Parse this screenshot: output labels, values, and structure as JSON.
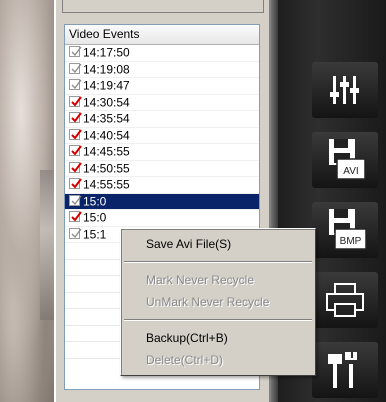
{
  "list": {
    "header": "Video Events",
    "events": [
      {
        "time": "14:17:50",
        "marked": false
      },
      {
        "time": "14:19:08",
        "marked": false
      },
      {
        "time": "14:19:47",
        "marked": false
      },
      {
        "time": "14:30:54",
        "marked": true
      },
      {
        "time": "14:35:54",
        "marked": true
      },
      {
        "time": "14:40:54",
        "marked": true
      },
      {
        "time": "14:45:55",
        "marked": true
      },
      {
        "time": "14:50:55",
        "marked": true
      },
      {
        "time": "14:55:55",
        "marked": true
      },
      {
        "time": "15:0",
        "marked": false,
        "selected": true
      },
      {
        "time": "15:0",
        "marked": true
      },
      {
        "time": "15:1",
        "marked": false
      }
    ]
  },
  "context_menu": {
    "items": [
      {
        "label": "Save Avi File(S)",
        "enabled": true
      },
      {
        "separator": true
      },
      {
        "label": "Mark Never Recycle",
        "enabled": false
      },
      {
        "label": "UnMark Never Recycle",
        "enabled": false
      },
      {
        "separator": true
      },
      {
        "label": "Backup(Ctrl+B)",
        "enabled": true
      },
      {
        "label": "Delete(Ctrl+D)",
        "enabled": false
      }
    ]
  },
  "toolbar": {
    "buttons": [
      {
        "icon": "sliders-icon"
      },
      {
        "icon": "save-avi-icon",
        "badge": "AVI"
      },
      {
        "icon": "save-bmp-icon",
        "badge": "BMP"
      },
      {
        "icon": "printer-icon"
      },
      {
        "icon": "tools-icon"
      }
    ]
  },
  "colors": {
    "selection": "#0a246a",
    "check_red": "#d40000",
    "check_gray": "#8a8a8a",
    "panel": "#d4d0c8"
  }
}
